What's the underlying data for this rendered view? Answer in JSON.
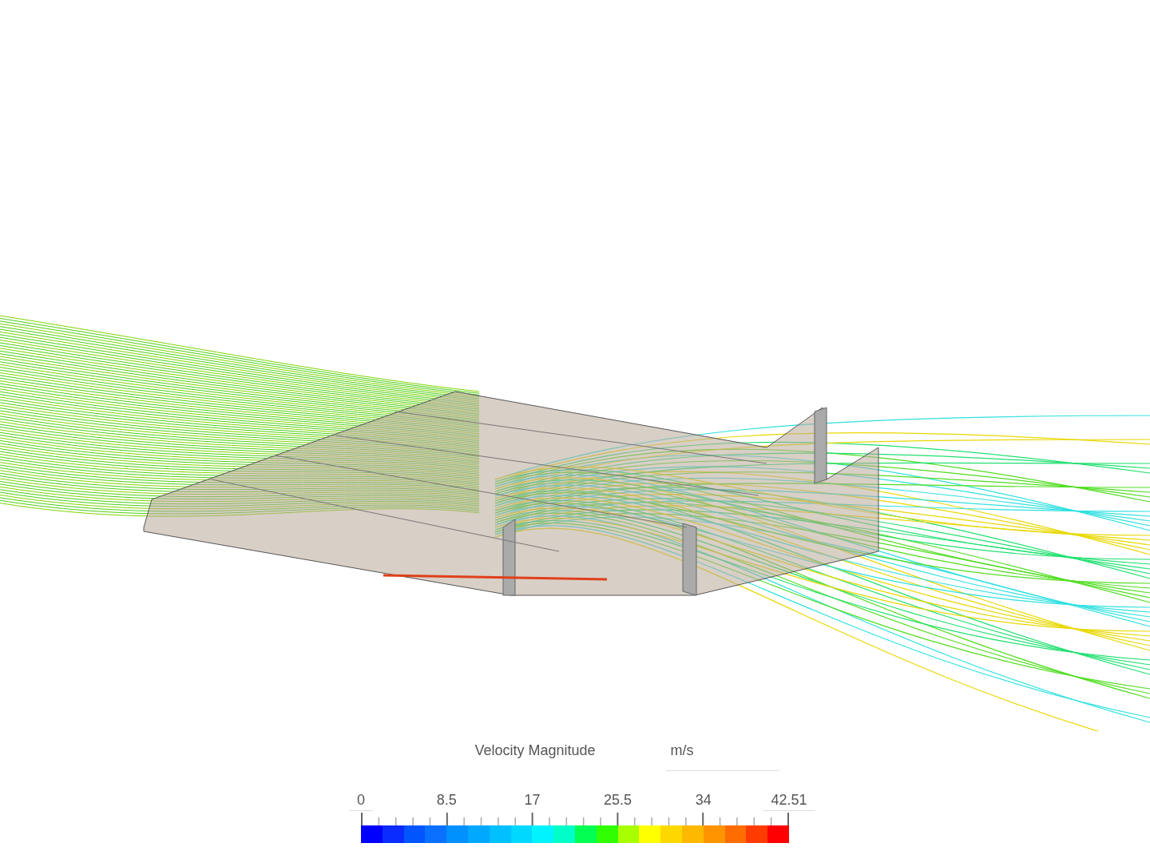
{
  "legend": {
    "title": "Velocity Magnitude",
    "unit": "m/s",
    "ticks": [
      "0",
      "8.5",
      "17",
      "25.5",
      "34",
      "42.51"
    ]
  }
}
